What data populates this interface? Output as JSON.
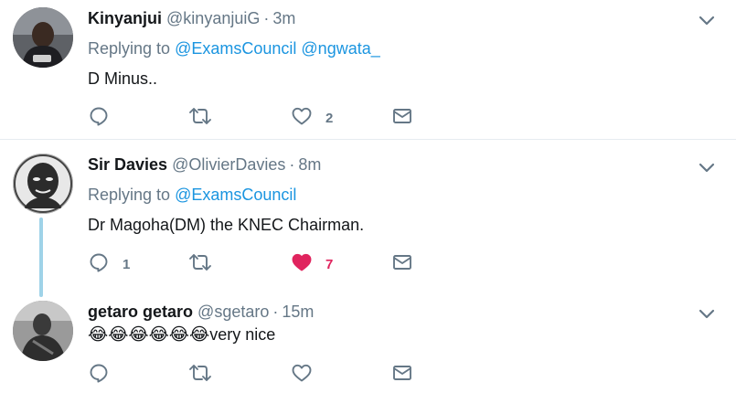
{
  "tweets": [
    {
      "name": "Kinyanjui",
      "handle": "@kinyanjuiG",
      "time": "3m",
      "replying_prefix": "Replying to",
      "mentions": [
        "@ExamsCouncil",
        "@ngwata_"
      ],
      "text": "D Minus..",
      "reply_count": "",
      "retweet_count": "",
      "like_count": "2",
      "liked": false
    },
    {
      "name": "Sir Davies",
      "handle": "@OlivierDavies",
      "time": "8m",
      "replying_prefix": "Replying to",
      "mentions": [
        "@ExamsCouncil"
      ],
      "text": "Dr Magoha(DM) the KNEC Chairman.",
      "reply_count": "1",
      "retweet_count": "",
      "like_count": "7",
      "liked": true
    },
    {
      "name": "getaro getaro",
      "handle": "@sgetaro",
      "time": "15m",
      "emojis": "😂😂😂😂😂😂",
      "text": "very nice",
      "reply_count": "",
      "retweet_count": "",
      "like_count": "",
      "liked": false
    }
  ],
  "separator": "·",
  "icons": {
    "reply": "reply-icon",
    "retweet": "retweet-icon",
    "like": "heart-icon",
    "dm": "envelope-icon",
    "caret": "chevron-down-icon"
  },
  "colors": {
    "name": "#14171a",
    "muted": "#657786",
    "link": "#1b95e0",
    "like": "#e0245e",
    "thread_line": "#9fd3e8",
    "divider": "#e6ecf0"
  }
}
